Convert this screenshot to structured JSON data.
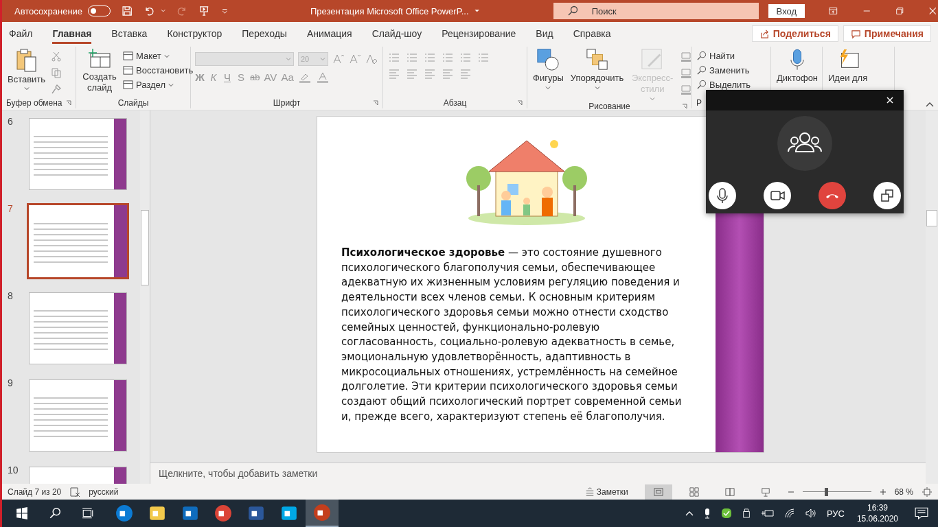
{
  "title_bar": {
    "autosave_label": "Автосохранение",
    "autosave_on": false,
    "title": "Презентация Microsoft Office PowerP...",
    "search_placeholder": "Поиск",
    "signin": "Вход"
  },
  "menu_tabs": [
    {
      "label": "Файл",
      "selected": false
    },
    {
      "label": "Главная",
      "selected": true
    },
    {
      "label": "Вставка",
      "selected": false
    },
    {
      "label": "Конструктор",
      "selected": false
    },
    {
      "label": "Переходы",
      "selected": false
    },
    {
      "label": "Анимация",
      "selected": false
    },
    {
      "label": "Слайд-шоу",
      "selected": false
    },
    {
      "label": "Рецензирование",
      "selected": false
    },
    {
      "label": "Вид",
      "selected": false
    },
    {
      "label": "Справка",
      "selected": false
    }
  ],
  "share": "Поделиться",
  "comments": "Примечания",
  "ribbon": {
    "clipboard": {
      "title": "Буфер обмена",
      "paste": "Вставить"
    },
    "slides": {
      "title": "Слайды",
      "new_slide": "Создать слайд",
      "items": [
        "Макет",
        "Восстановить",
        "Раздел"
      ]
    },
    "font": {
      "title": "Шрифт",
      "size": "20",
      "format_buttons": [
        "Ж",
        "К",
        "Ч",
        "S",
        "ab",
        "AV",
        "Aa"
      ]
    },
    "paragraph": {
      "title": "Абзац"
    },
    "drawing": {
      "title": "Рисование",
      "items": [
        {
          "label": "Фигуры",
          "disabled": false
        },
        {
          "label": "Упорядочить",
          "disabled": false
        },
        {
          "label": "Экспресс-стили",
          "disabled": true
        }
      ]
    },
    "editing": {
      "title": "Р",
      "items": [
        "Найти",
        "Заменить",
        "Выделить"
      ]
    },
    "voice": "Диктофон",
    "designer": "Идеи для"
  },
  "thumbnails": [
    {
      "number": "6",
      "selected": false
    },
    {
      "number": "7",
      "selected": true
    },
    {
      "number": "8",
      "selected": false
    },
    {
      "number": "9",
      "selected": false
    },
    {
      "number": "10",
      "selected": false
    }
  ],
  "slide": {
    "text": "**Психологическое здоровье** — это состояние душевного психологического благополучия семьи, обеспечивающее адекватную их жизненным условиям регуляцию поведения и деятельности всех членов семьи. К основным критериям психологического здоровья семьи можно отнести сходство семейных ценностей, функционально-ролевую согласованность, социально-ролевую адекватность в семье, эмоциональную удовлетворённость, адаптивность в микросоциальных отношениях, устремлённость на семейное долголетие. Эти критерии психологического здоровья семьи создают общий психологический портрет современной семьи и, прежде всего, характеризуют степень её благополучия."
  },
  "notes_placeholder": "Щелкните, чтобы добавить заметки",
  "status_bar": {
    "slide_counter": "Слайд 7 из 20",
    "language": "русский",
    "notes": "Заметки",
    "views": [
      {
        "selected": true
      },
      {
        "selected": false
      },
      {
        "selected": false
      },
      {
        "selected": false
      }
    ],
    "zoom": {
      "level": 0.32,
      "reading": "68 %"
    }
  },
  "taskbar": {
    "apps": [
      {
        "color": "#0c7bd4",
        "active": false
      },
      {
        "color": "#f2c94c",
        "active": false
      },
      {
        "color": "#0f6cbd",
        "active": false
      },
      {
        "color": "#db4437",
        "active": false
      },
      {
        "color": "#2b579a",
        "active": false
      },
      {
        "color": "#00a8e6",
        "active": false
      },
      {
        "color": "#c43e1c",
        "active": true
      }
    ],
    "language": "РУС",
    "time": "16:39",
    "date": "15.06.2020"
  }
}
